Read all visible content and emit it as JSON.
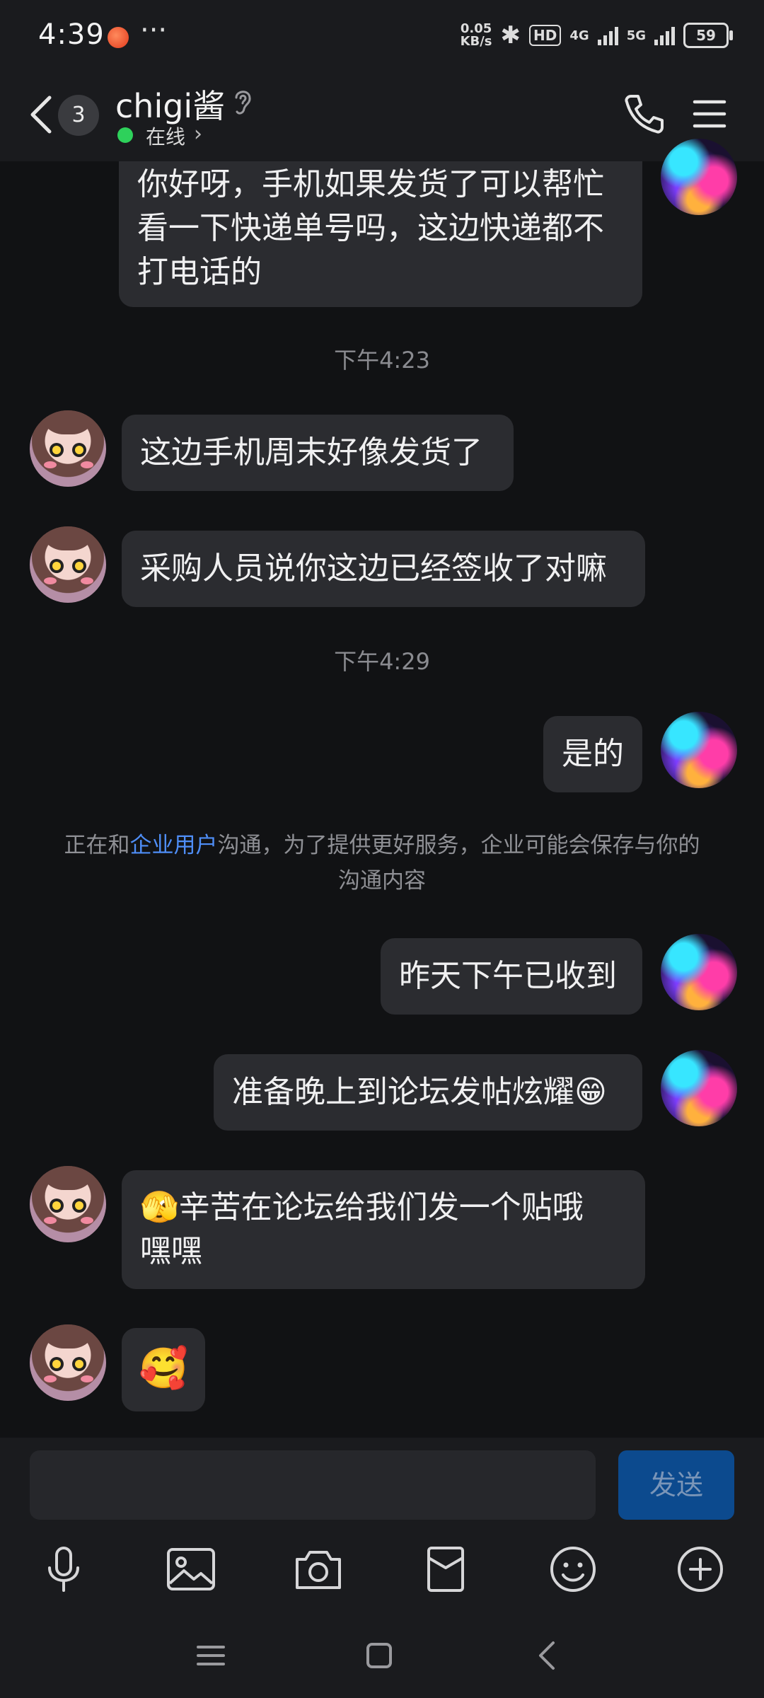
{
  "status_bar": {
    "time": "4:39",
    "more": "···",
    "net_speed_value": "0.05",
    "net_speed_unit": "KB/s",
    "hd_label": "HD",
    "net_4g": "4G",
    "net_5g": "5G",
    "battery": "59"
  },
  "header": {
    "unread_count": "3",
    "contact_name": "chigi酱",
    "status": "在线"
  },
  "messages": [
    {
      "sender": "me",
      "text_lines": [
        "你好呀，手机如果发货了可以帮忙",
        "看一下快递单号吗，这边快递都不",
        "打电话的"
      ]
    },
    {
      "type": "timestamp",
      "text": "下午4:23"
    },
    {
      "sender": "contact",
      "text": "这边手机周末好像发货了"
    },
    {
      "sender": "contact",
      "text": "采购人员说你这边已经签收了对嘛"
    },
    {
      "type": "timestamp",
      "text": "下午4:29"
    },
    {
      "sender": "me",
      "text": "是的"
    },
    {
      "sender": "me",
      "text": "昨天下午已收到"
    },
    {
      "sender": "me",
      "text": "准备晚上到论坛发帖炫耀😁"
    },
    {
      "sender": "contact",
      "text_lines": [
        "🫣辛苦在论坛给我们发一个贴哦",
        "嘿嘿"
      ]
    },
    {
      "sender": "contact",
      "emoji": "🥰"
    }
  ],
  "notice": {
    "prefix": "正在和",
    "link": "企业用户",
    "line1_suffix": "沟通，为了提供更好服务，企业可能会保存与你的",
    "line2": "沟通内容"
  },
  "input": {
    "value": "",
    "send_label": "发送"
  },
  "toolbar": [
    "microphone-icon",
    "image-icon",
    "camera-icon",
    "red-packet-icon",
    "emoji-icon",
    "plus-icon"
  ],
  "colors": {
    "background": "#111214",
    "bubble": "#2b2c30",
    "link": "#4f8ef7",
    "online": "#2ed15b",
    "send_button": "#0c4a8e"
  }
}
